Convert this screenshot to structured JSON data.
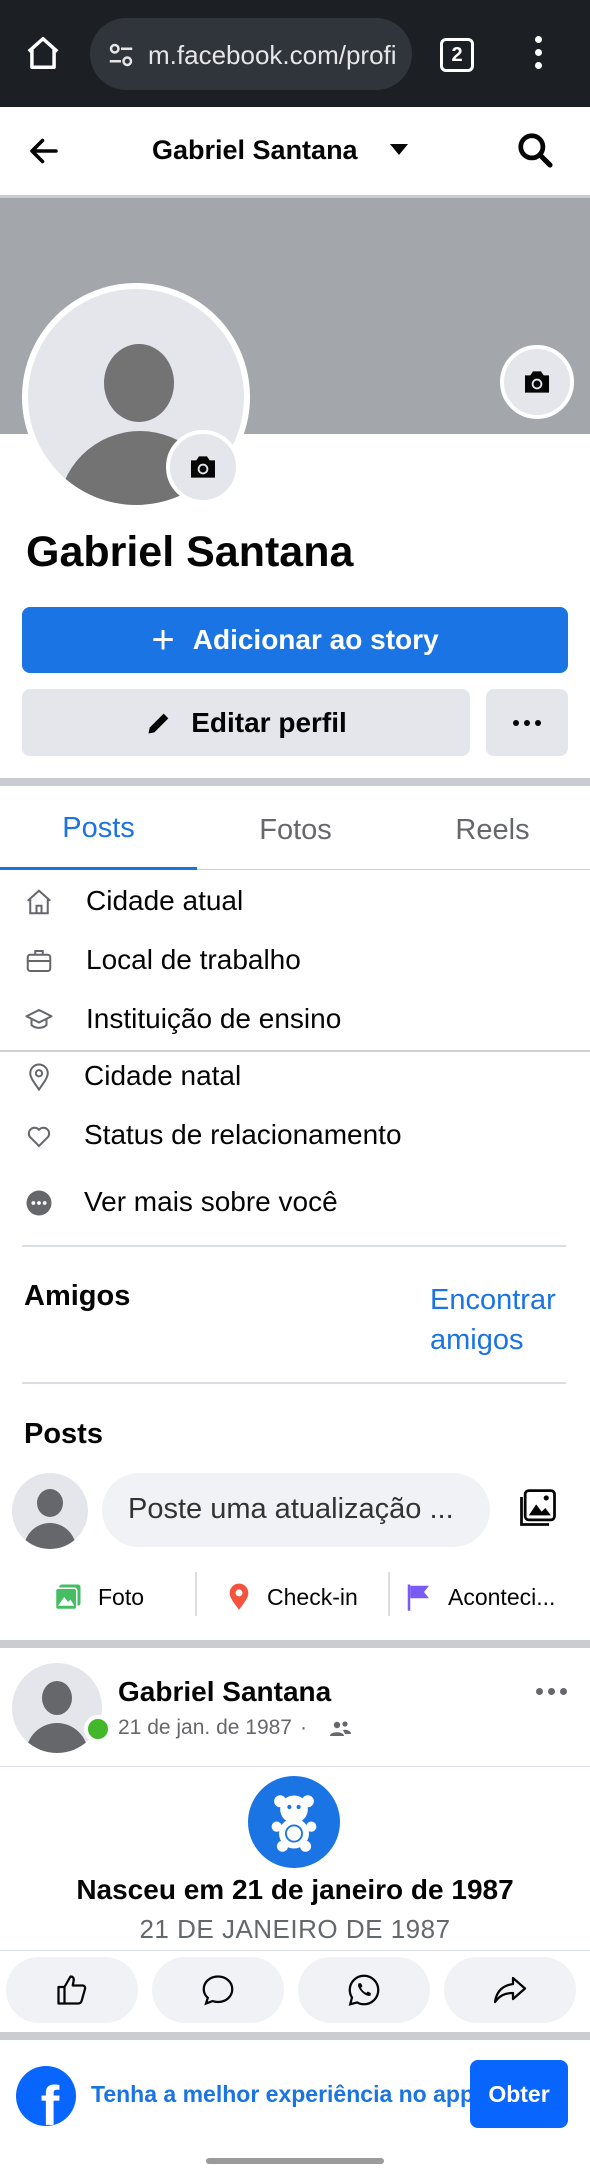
{
  "browser": {
    "url": "m.facebook.com/profile",
    "tab_count": "2"
  },
  "header": {
    "title": "Gabriel Santana"
  },
  "profile": {
    "name": "Gabriel Santana",
    "add_story_label": "Adicionar ao story",
    "edit_profile_label": "Editar perfil"
  },
  "tabs": [
    {
      "label": "Posts",
      "active": true
    },
    {
      "label": "Fotos",
      "active": false
    },
    {
      "label": "Reels",
      "active": false
    }
  ],
  "info_items": [
    {
      "icon": "home-icon",
      "label": "Cidade atual"
    },
    {
      "icon": "briefcase-icon",
      "label": "Local de trabalho"
    },
    {
      "icon": "graduation-cap-icon",
      "label": "Instituição de ensino"
    },
    {
      "icon": "location-pin-icon",
      "label": "Cidade natal"
    },
    {
      "icon": "heart-icon",
      "label": "Status de relacionamento"
    },
    {
      "icon": "more-dots-icon",
      "label": "Ver mais sobre você"
    }
  ],
  "friends": {
    "title": "Amigos",
    "find_label": "Encontrar amigos"
  },
  "posts_section": {
    "title": "Posts",
    "composer_placeholder": "Poste uma atualização ...",
    "actions": [
      {
        "icon": "photo-icon",
        "label": "Foto",
        "color": "#45bd62"
      },
      {
        "icon": "location-pin-icon",
        "label": "Check-in",
        "color": "#f5533d"
      },
      {
        "icon": "flag-icon",
        "label": "Aconteci...",
        "color": "#7a5af5"
      }
    ]
  },
  "post": {
    "author": "Gabriel Santana",
    "date": "21 de jan. de 1987",
    "separator": "·",
    "audience_icon": "friends-icon",
    "life_event_icon": "teddy-bear-icon",
    "life_event_title": "Nasceu em 21 de janeiro de 1987",
    "life_event_date": "21 DE JANEIRO DE 1987",
    "reaction_buttons": [
      "like-icon",
      "comment-icon",
      "whatsapp-icon",
      "share-icon"
    ]
  },
  "app_banner": {
    "text": "Tenha a melhor experiência no app",
    "button_label": "Obter",
    "logo_letter": "f"
  },
  "colors": {
    "accent": "#1b74e4",
    "online": "#42b72a",
    "cover": "#a3a6aa"
  }
}
